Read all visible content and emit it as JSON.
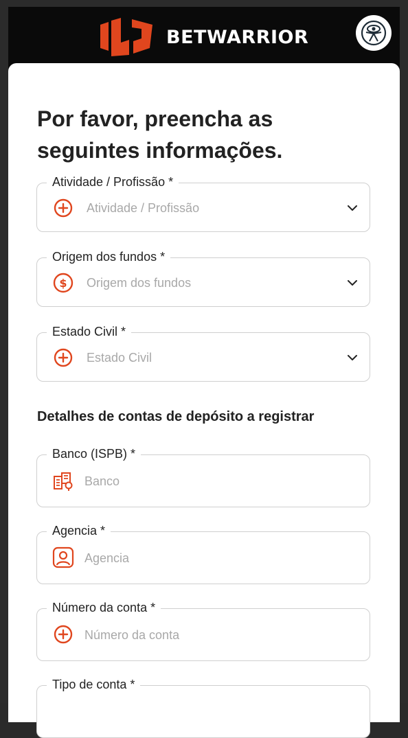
{
  "header": {
    "brand_name": "BETWARRIOR",
    "logo_icon": "betwarrior-w-logo",
    "accessibility_icon": "accessibility-icon"
  },
  "form": {
    "title": "Por favor, preencha as seguintes informações.",
    "fields": [
      {
        "label": "Atividade / Profissão *",
        "placeholder": "Atividade / Profissão",
        "icon": "plus-circle-icon",
        "type": "select"
      },
      {
        "label": "Origem dos fundos *",
        "placeholder": "Origem dos fundos",
        "icon": "dollar-circle-icon",
        "type": "select"
      },
      {
        "label": "Estado Civil *",
        "placeholder": "Estado Civil",
        "icon": "plus-circle-icon",
        "type": "select"
      }
    ],
    "section_title": "Detalhes de contas de depósito a registrar",
    "deposit_fields": [
      {
        "label": "Banco (ISPB) *",
        "placeholder": "Banco",
        "icon": "bank-building-icon"
      },
      {
        "label": "Agencia *",
        "placeholder": "Agencia",
        "icon": "person-badge-icon"
      },
      {
        "label": "Número da conta *",
        "placeholder": "Número da conta",
        "icon": "plus-circle-icon"
      },
      {
        "label": "Tipo de conta *",
        "placeholder": "",
        "icon": ""
      }
    ]
  },
  "colors": {
    "accent": "#E0461E",
    "header_bg": "#0A0A0A",
    "border": "#CFCFCF",
    "placeholder": "#A8A8A8"
  }
}
